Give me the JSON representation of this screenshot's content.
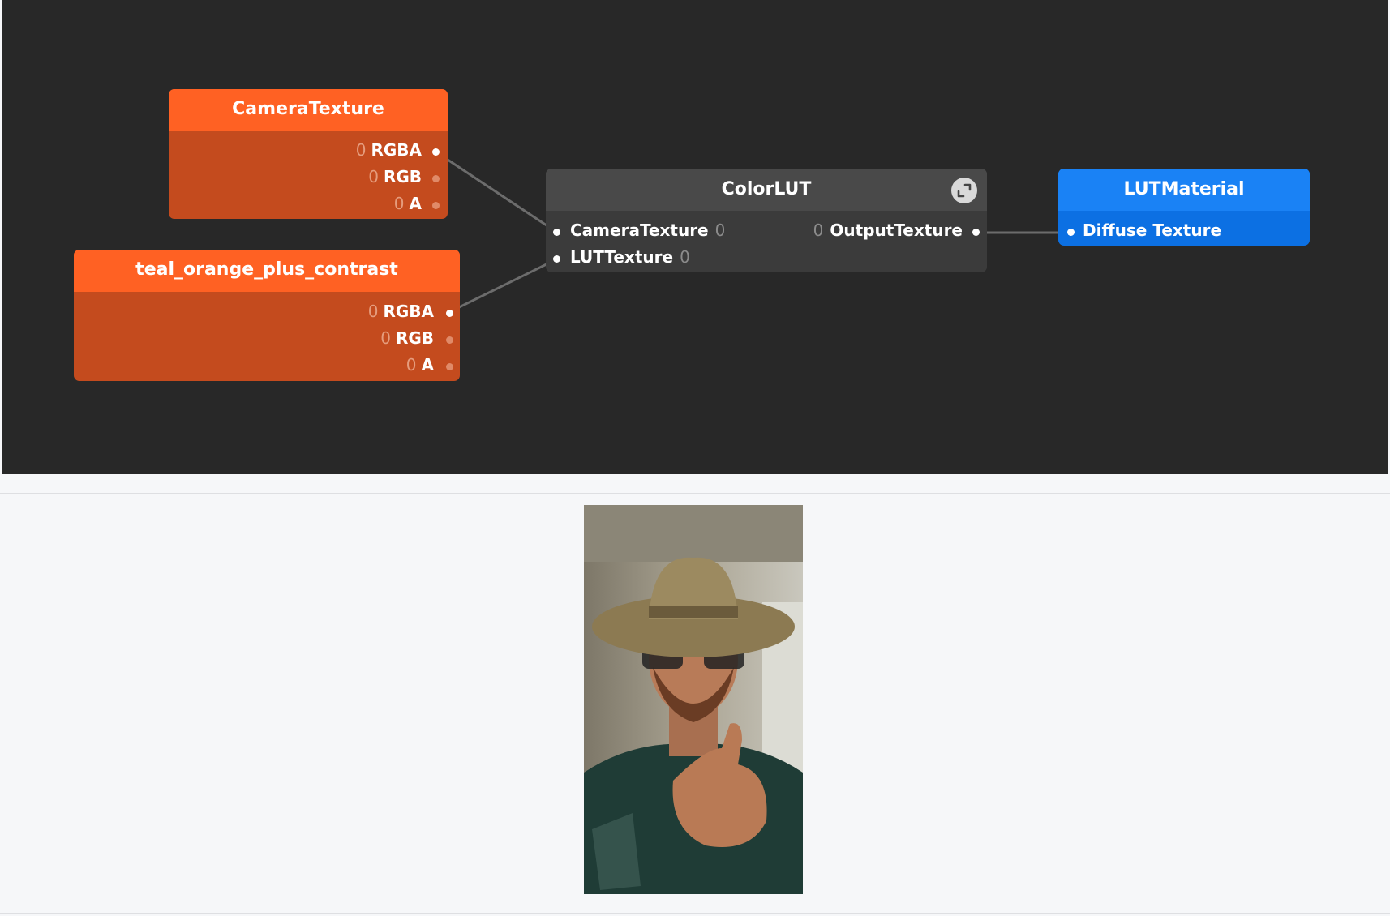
{
  "nodes": {
    "camera_texture": {
      "title": "CameraTexture",
      "outputs": [
        {
          "label": "RGBA",
          "count": "0"
        },
        {
          "label": "RGB",
          "count": "0"
        },
        {
          "label": "A",
          "count": "0"
        }
      ]
    },
    "lut_texture": {
      "title": "teal_orange_plus_contrast",
      "outputs": [
        {
          "label": "RGBA",
          "count": "0"
        },
        {
          "label": "RGB",
          "count": "0"
        },
        {
          "label": "A",
          "count": "0"
        }
      ]
    },
    "color_lut": {
      "title": "ColorLUT",
      "inputs": [
        {
          "label": "CameraTexture",
          "count": "0"
        },
        {
          "label": "LUTTexture",
          "count": "0"
        }
      ],
      "outputs": [
        {
          "label": "OutputTexture",
          "count": "0"
        }
      ],
      "expand_icon": "expand-icon"
    },
    "lut_material": {
      "title": "LUTMaterial",
      "inputs": [
        {
          "label": "Diffuse Texture"
        }
      ]
    }
  },
  "colors": {
    "canvas_bg": "#282828",
    "patch_orange_header": "#ff6123",
    "patch_orange_body": "#c44b1e",
    "patch_gray_header": "#494949",
    "patch_blue_header": "#1a82f5",
    "page_bg": "#f6f7f9"
  }
}
